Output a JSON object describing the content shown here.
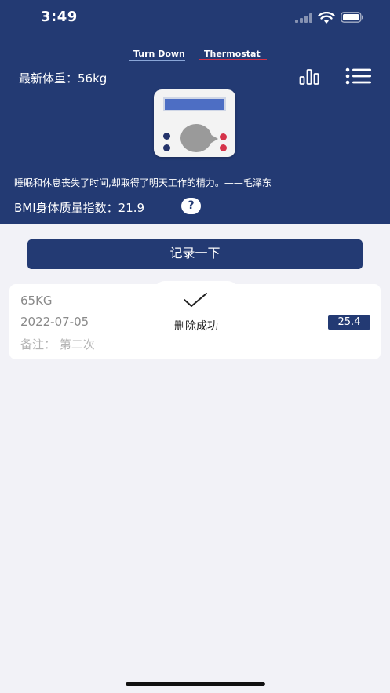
{
  "status_bar": {
    "time": "3:49"
  },
  "logo": {
    "left_text": "Turn Down",
    "right_text": "Thermostat"
  },
  "header": {
    "latest_weight": "最新体重：56kg",
    "quote": "睡眠和休息丧失了时间,却取得了明天工作的精力。——毛泽东",
    "bmi_label": "BMI身体质量指数：21.9",
    "help_symbol": "?"
  },
  "actions": {
    "record_button": "记录一下"
  },
  "records": [
    {
      "weight": "65KG",
      "date": "2022-07-05",
      "note": "备注：  第二次",
      "bmi": "25.4"
    }
  ],
  "toast": {
    "message": "删除成功"
  },
  "colors": {
    "primary": "#233a73",
    "background": "#f2f2f7",
    "accent_red": "#d5334a"
  },
  "icons": [
    "signal-icon",
    "wifi-icon",
    "battery-icon",
    "chart-icon",
    "menu-icon",
    "help-icon",
    "check-icon"
  ]
}
